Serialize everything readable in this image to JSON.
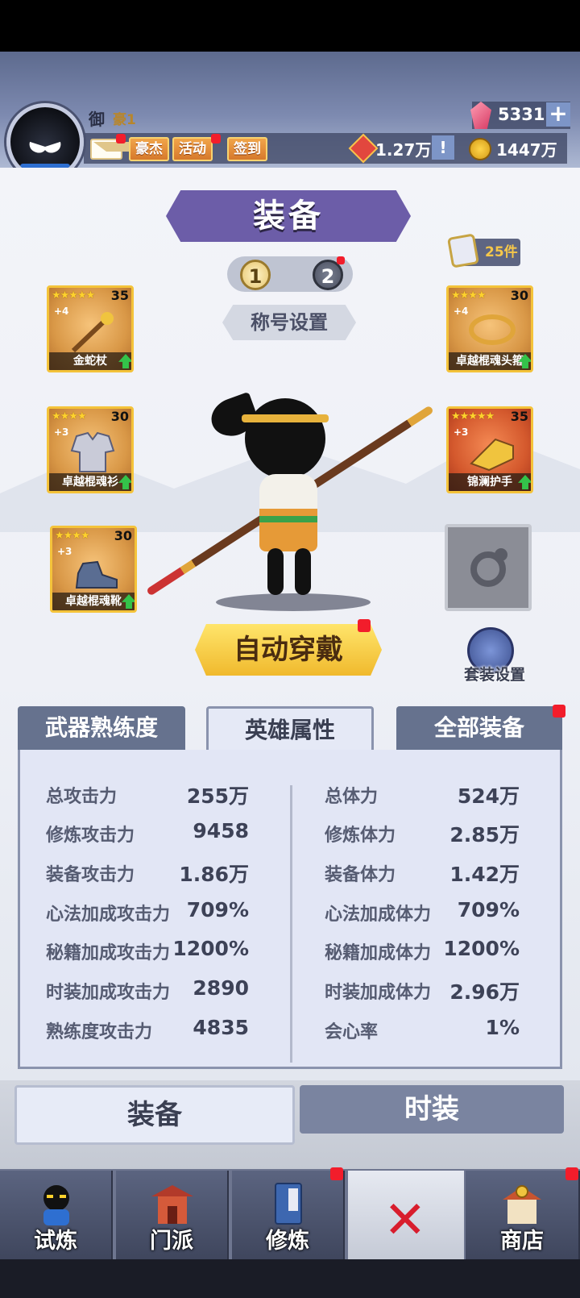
{
  "player": {
    "name": "御",
    "rank": "豪1"
  },
  "header": {
    "chips": [
      "豪杰",
      "活动",
      "签到"
    ],
    "honor_value": "1.27万",
    "honor_info": "!",
    "coin_value": "1447万",
    "gem_value": "5331",
    "gem_add": "+"
  },
  "page": {
    "title": "装备",
    "loadout_tabs": [
      "1",
      "2"
    ],
    "title_setting": "称号设置",
    "bag_count": "25件"
  },
  "equipment": {
    "left": [
      {
        "name": "金蛇杖",
        "stars": "★★★★★",
        "level": "35",
        "plus": "+4"
      },
      {
        "name": "卓越棍魂衫",
        "stars": "★★★★",
        "level": "30",
        "plus": "+3"
      },
      {
        "name": "卓越棍魂靴",
        "stars": "★★★★",
        "level": "30",
        "plus": "+3"
      }
    ],
    "right": [
      {
        "name": "卓越棍魂头箍",
        "stars": "★★★★",
        "level": "30",
        "plus": "+4"
      },
      {
        "name": "锦澜护手",
        "stars": "★★★★★",
        "level": "35",
        "plus": "+3"
      }
    ]
  },
  "actions": {
    "auto_equip": "自动穿戴",
    "suit_setting": "套装设置"
  },
  "attr_tabs": [
    "武器熟练度",
    "英雄属性",
    "全部装备"
  ],
  "stats": {
    "left": [
      {
        "name": "总攻击力",
        "value": "255万"
      },
      {
        "name": "修炼攻击力",
        "value": "9458"
      },
      {
        "name": "装备攻击力",
        "value": "1.86万"
      },
      {
        "name": "心法加成攻击力",
        "value": "709%"
      },
      {
        "name": "秘籍加成攻击力",
        "value": "1200%"
      },
      {
        "name": "时装加成攻击力",
        "value": "2890"
      },
      {
        "name": "熟练度攻击力",
        "value": "4835"
      }
    ],
    "right": [
      {
        "name": "总体力",
        "value": "524万"
      },
      {
        "name": "修炼体力",
        "value": "2.85万"
      },
      {
        "name": "装备体力",
        "value": "1.42万"
      },
      {
        "name": "心法加成体力",
        "value": "709%"
      },
      {
        "name": "秘籍加成体力",
        "value": "1200%"
      },
      {
        "name": "时装加成体力",
        "value": "2.96万"
      },
      {
        "name": "会心率",
        "value": "1%"
      }
    ]
  },
  "bottom_tabs": [
    "装备",
    "时装"
  ],
  "nav": {
    "items": [
      "试炼",
      "门派",
      "修炼",
      "商店"
    ],
    "close": "✕"
  },
  "colors": {
    "accent_purple": "#6c5da8",
    "gold": "#f4c33a",
    "alert_red": "#f21d2b"
  }
}
